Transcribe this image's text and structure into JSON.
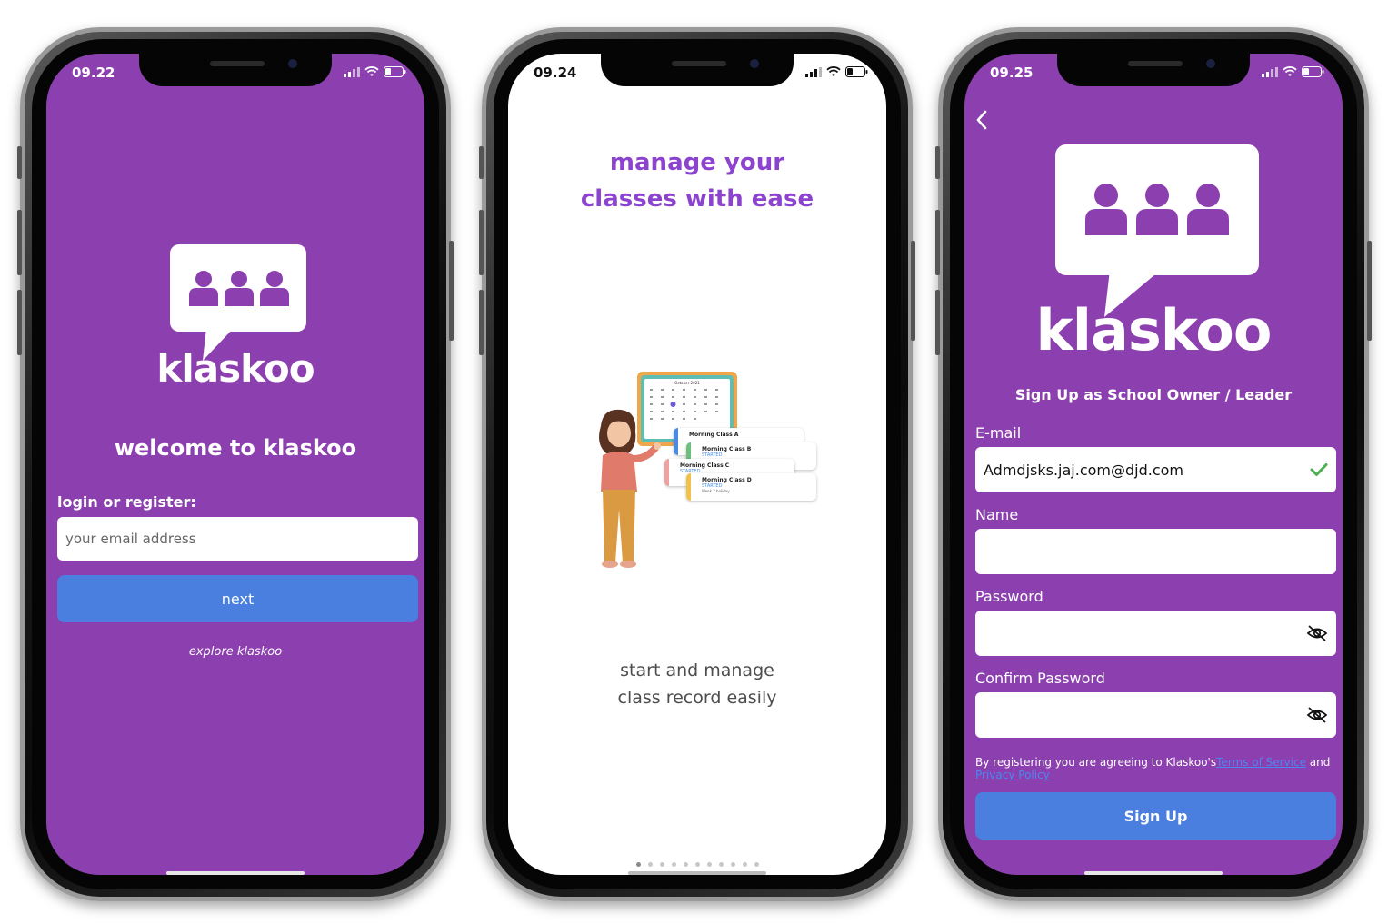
{
  "brand": {
    "name": "klaskoo",
    "primary_color": "#8c3fae",
    "button_color": "#4a7fdf",
    "heading_color": "#8c44cf"
  },
  "phone1": {
    "time": "09.22",
    "logo_text": "klaskoo",
    "welcome": "welcome to klaskoo",
    "login_label": "login or register:",
    "email_placeholder": "your email address",
    "next_button": "next",
    "explore_link": "explore klaskoo"
  },
  "phone2": {
    "time": "09.24",
    "headline_line1": "manage your",
    "headline_line2": "classes with ease",
    "subtitle_line1": "start and manage",
    "subtitle_line2": "class record easily",
    "page_dots": {
      "count": 11,
      "active_index": 0
    },
    "illustration": {
      "calendar_month": "October 2021",
      "cards": [
        {
          "name": "Morning Class A"
        },
        {
          "name": "Morning Class B",
          "status": "STARTED"
        },
        {
          "name": "Morning Class C",
          "status": "STARTED"
        },
        {
          "name": "Morning Class D",
          "status": "STARTED",
          "note": "Week 2 holiday"
        }
      ]
    }
  },
  "phone3": {
    "time": "09.25",
    "logo_text": "klaskoo",
    "title": "Sign Up as School Owner / Leader",
    "email_label": "E-mail",
    "email_value": "Admdjsks.jaj.com@djd.com",
    "name_label": "Name",
    "password_label": "Password",
    "confirm_label": "Confirm Password",
    "terms_prefix": "By registering you are agreeing to Klaskoo's",
    "terms_link": "Terms of Service",
    "terms_and": " and",
    "privacy_link": "Privacy Policy",
    "signup_button": "Sign Up"
  }
}
